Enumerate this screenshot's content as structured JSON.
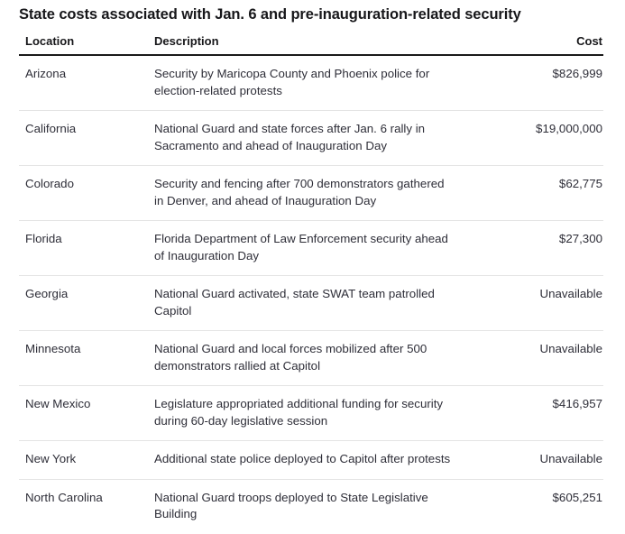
{
  "page_title": "State costs associated with Jan. 6 and pre-inauguration-related security",
  "table": {
    "columns": {
      "location": "Location",
      "description": "Description",
      "cost": "Cost"
    },
    "rows": [
      {
        "location": "Arizona",
        "description": "Security by Maricopa County and Phoenix police for election-related protests",
        "cost": "$826,999"
      },
      {
        "location": "California",
        "description": "National Guard and state forces after Jan. 6 rally in Sacramento and ahead of Inauguration Day",
        "cost": "$19,000,000"
      },
      {
        "location": "Colorado",
        "description": "Security and fencing after 700 demonstrators gathered in Denver, and ahead of Inauguration Day",
        "cost": "$62,775"
      },
      {
        "location": "Florida",
        "description": "Florida Department of Law Enforcement security ahead of Inauguration Day",
        "cost": "$27,300"
      },
      {
        "location": "Georgia",
        "description": "National Guard activated, state SWAT team patrolled Capitol",
        "cost": "Unavailable"
      },
      {
        "location": "Minnesota",
        "description": "National Guard and local forces mobilized after 500 demonstrators rallied at Capitol",
        "cost": "Unavailable"
      },
      {
        "location": "New Mexico",
        "description": "Legislature appropriated additional funding for security during 60-day legislative session",
        "cost": "$416,957"
      },
      {
        "location": "New York",
        "description": "Additional state police deployed to Capitol after protests",
        "cost": "Unavailable"
      },
      {
        "location": "North Carolina",
        "description": "National Guard troops deployed to State Legislative Building",
        "cost": "$605,251"
      }
    ]
  },
  "colors": {
    "title_text": "#17171a",
    "body_text": "#2e2e38",
    "header_rule": "#1a1a1a",
    "row_rule": "#e4e4e4",
    "background": "#ffffff"
  }
}
